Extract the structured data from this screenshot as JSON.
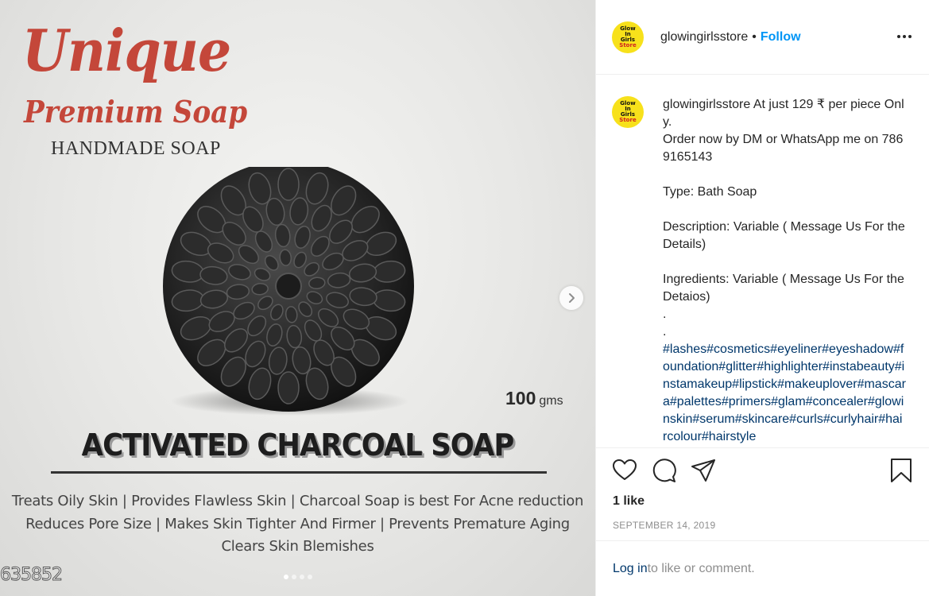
{
  "media": {
    "brand_line1": "Unique",
    "brand_line2": "Premium Soap",
    "brand_line3": "HANDMADE SOAP",
    "weight_value": "100",
    "weight_unit": "gms",
    "headline": "ACTIVATED CHARCOAL SOAP",
    "benefits_line1": "Treats Oily Skin  |  Provides Flawless Skin  | Charcoal Soap is best For Acne reduction",
    "benefits_line2": "Reduces Pore Size  |  Makes Skin Tighter And Firmer  | Prevents Premature Aging",
    "benefits_line3": "Clears Skin Blemishes",
    "product_code": "635852",
    "carousel_total": 4,
    "carousel_active": 1
  },
  "post": {
    "username": "glowingirlsstore",
    "separator": "•",
    "follow_label": "Follow",
    "avatar_text": [
      "Glow",
      "In",
      "Girls",
      "Store"
    ],
    "caption": {
      "username": "glowingirlsstore",
      "body": " At just 129 ₹ per piece Only.\nOrder now by DM or WhatsApp me on 7869165143\n\nType: Bath Soap\n\nDescription: Variable ( Message Us For the Details)\n\nIngredients: Variable ( Message Us For the Detaios)\n.\n.\n",
      "hashtags": "#lashes#cosmetics#eyeliner#eyeshadow#foundation#glitter#highlighter#instabeauty#instamakeup#lipstick#makeuplover#mascara#palettes#primers#glam#concealer#glowinskin#serum#skincare#curls#curlyhair#haircolour#hairstyle"
    },
    "likes": "1 like",
    "date": "SEPTEMBER 14, 2019",
    "login_link": "Log in",
    "login_rest": " to like or comment."
  },
  "colors": {
    "brand_red": "#c4473a",
    "follow_blue": "#0095f6",
    "link_blue": "#00376b",
    "avatar_yellow": "#f7e11b",
    "muted_gray": "#8e8e8e"
  },
  "icons": [
    "heart-icon",
    "comment-icon",
    "share-icon",
    "bookmark-icon",
    "more-options-icon",
    "chevron-right-icon"
  ]
}
